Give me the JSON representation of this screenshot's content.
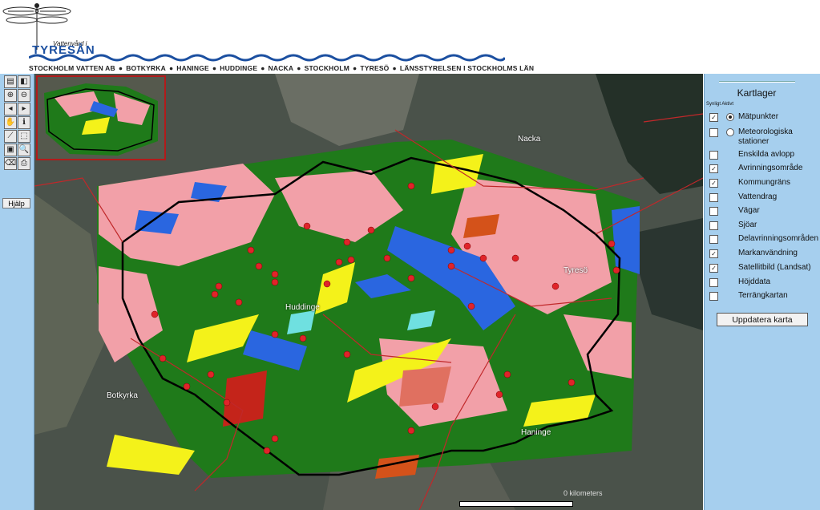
{
  "header": {
    "logo_small": "Vattenvård i",
    "logo_big": "TYRESÅN",
    "municipalities": [
      "STOCKHOLM VATTEN AB",
      "BOTKYRKA",
      "HANINGE",
      "HUDDINGE",
      "NACKA",
      "STOCKHOLM",
      "TYRESÖ",
      "LÄNSSTYRELSEN I STOCKHOLMS LÄN"
    ]
  },
  "toolbar": {
    "help_label": "Hjälp",
    "tools": [
      "full-extent-icon",
      "overview-toggle-icon",
      "zoom-in-icon",
      "zoom-out-icon",
      "zoom-previous-icon",
      "zoom-next-icon",
      "pan-icon",
      "info-icon",
      "measure-icon",
      "select-icon",
      "select-rectangle-icon",
      "query-icon",
      "clear-icon",
      "print-icon"
    ]
  },
  "map": {
    "place_labels": [
      "Nacka",
      "Tyresö",
      "Huddinge",
      "Botkyrka",
      "Haninge"
    ],
    "scale_label": "0 kilometers"
  },
  "layers_panel": {
    "title": "Kartlager",
    "col_visible": "Synligt",
    "col_active": "Aktivt",
    "update_label": "Uppdatera karta",
    "layers": [
      {
        "name": "Mätpunkter",
        "visible": true,
        "radio": "on"
      },
      {
        "name": "Meteorologiska stationer",
        "visible": false,
        "radio": "off"
      },
      {
        "name": "Enskilda avlopp",
        "visible": false
      },
      {
        "name": "Avrinningsområde",
        "visible": true
      },
      {
        "name": "Kommungräns",
        "visible": true
      },
      {
        "name": "Vattendrag",
        "visible": false
      },
      {
        "name": "Vägar",
        "visible": false
      },
      {
        "name": "Sjöar",
        "visible": false
      },
      {
        "name": "Delavrinningsområden",
        "visible": false
      },
      {
        "name": "Markanvändning",
        "visible": true
      },
      {
        "name": "Satellitbild (Landsat)",
        "visible": true
      },
      {
        "name": "Höjddata",
        "visible": false
      },
      {
        "name": "Terrängkartan",
        "visible": false
      }
    ]
  },
  "colors": {
    "panel_bg": "#a6cfee",
    "forest": "#1f7a1a",
    "urban": "#f2a0a8",
    "agriculture": "#f4f21a",
    "water": "#2a66e0",
    "industry": "#d4521a",
    "border_red": "#c0282a",
    "catchment_black": "#000000",
    "points": "#e0242a"
  }
}
